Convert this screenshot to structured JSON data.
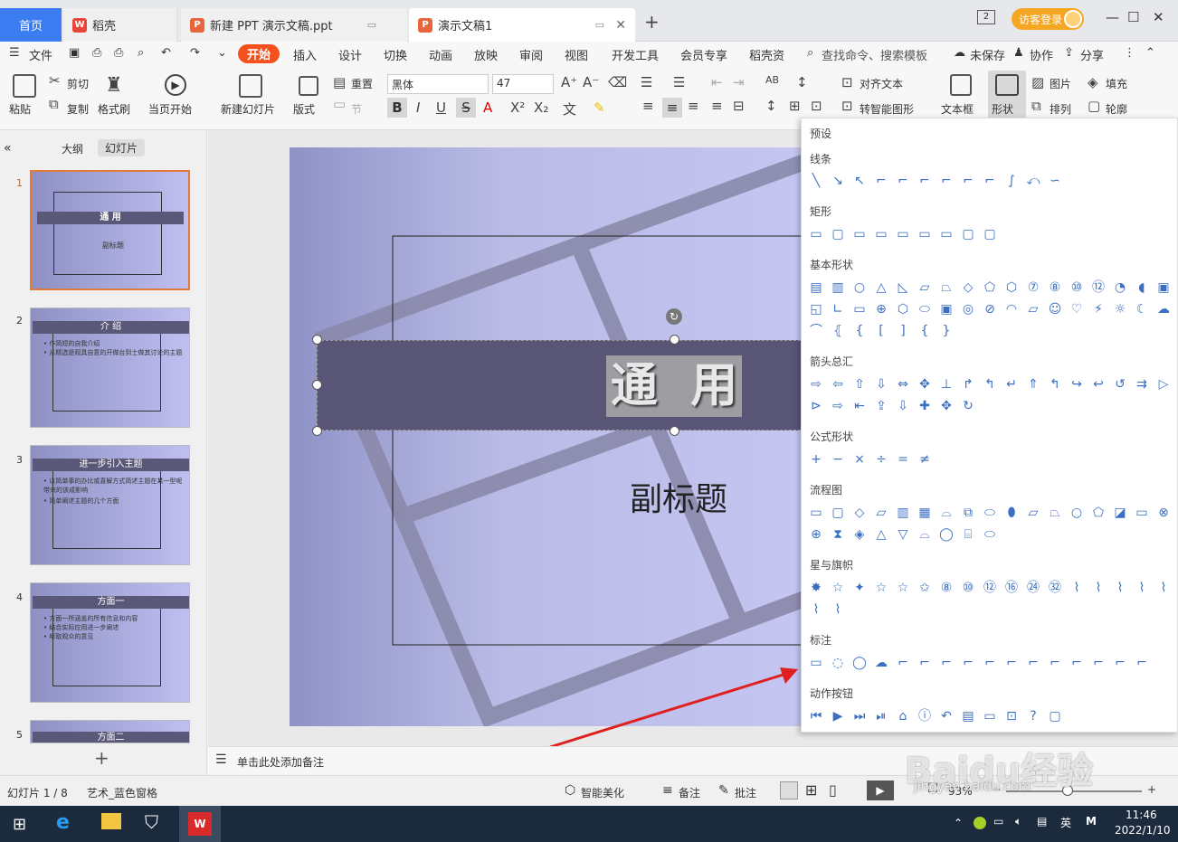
{
  "tabs": {
    "home": "首页",
    "docer": "稻壳",
    "ppt1": "新建 PPT 演示文稿.ppt",
    "ppt2": "演示文稿1",
    "login": "访客登录",
    "badge": "2"
  },
  "menu": {
    "file": "文件",
    "items": [
      "开始",
      "插入",
      "设计",
      "切换",
      "动画",
      "放映",
      "审阅",
      "视图",
      "开发工具",
      "会员专享",
      "稻壳资"
    ],
    "search": "查找命令、搜索模板",
    "unsaved": "未保存",
    "collab": "协作",
    "share": "分享"
  },
  "ribbon": {
    "paste": "粘贴",
    "cut": "剪切",
    "copy": "复制",
    "format_painter": "格式刷",
    "from_current": "当页开始",
    "new_slide": "新建幻灯片",
    "layout": "版式",
    "reset": "重置",
    "section": "节",
    "font": "黑体",
    "size": "47",
    "align_text": "对齐文本",
    "smart_shape": "转智能图形",
    "textbox": "文本框",
    "shape": "形状",
    "picture": "图片",
    "fill": "填充",
    "arrange": "排列",
    "outline": "轮廓"
  },
  "left_pane": {
    "tab_outline": "大纲",
    "tab_slides": "幻灯片",
    "thumbs": [
      {
        "num": "1",
        "title": "通  用",
        "sub": "副标题"
      },
      {
        "num": "2",
        "title": "介  绍",
        "bullets": [
          "• 作简短的自我介绍",
          "• 从精选是观具自意的开做台到士做其讨论的主题"
        ]
      },
      {
        "num": "3",
        "title": "进一步引入主题",
        "bullets": [
          "• 以简单事的办比或喜解方式简述主题在某一型呢带来的该成影响",
          "• 简单阐述主题的几个方面"
        ]
      },
      {
        "num": "4",
        "title": "方面一",
        "bullets": [
          "• 方面一所涵盖的所有信息和内容",
          "• 结合实际应用进一步阐述",
          "• 听取观众的意见"
        ]
      },
      {
        "num": "5",
        "title": "方面二"
      }
    ]
  },
  "slide": {
    "title": "通  用",
    "subtitle": "副标题"
  },
  "notes": "单击此处添加备注",
  "panel": {
    "header": "预设",
    "sections": [
      {
        "label": "线条",
        "count": 12
      },
      {
        "label": "矩形",
        "count": 9
      },
      {
        "label": "基本形状",
        "count": 42
      },
      {
        "label": "箭头总汇",
        "count": 27
      },
      {
        "label": "公式形状",
        "count": 6
      },
      {
        "label": "流程图",
        "count": 28
      },
      {
        "label": "星与旗帜",
        "count": 19
      },
      {
        "label": "标注",
        "count": 16
      },
      {
        "label": "动作按钮",
        "count": 12
      }
    ]
  },
  "status": {
    "slide_num": "幻灯片 1 / 8",
    "theme": "艺术_蓝色窗格",
    "smart": "智能美化",
    "notes": "备注",
    "comments": "批注",
    "zoom": "93%"
  },
  "taskbar": {
    "time": "11:46",
    "date": "2022/1/10",
    "ime": "英"
  },
  "watermark": "Baidu经验",
  "watermark_url": "jingyan.baidu.com"
}
